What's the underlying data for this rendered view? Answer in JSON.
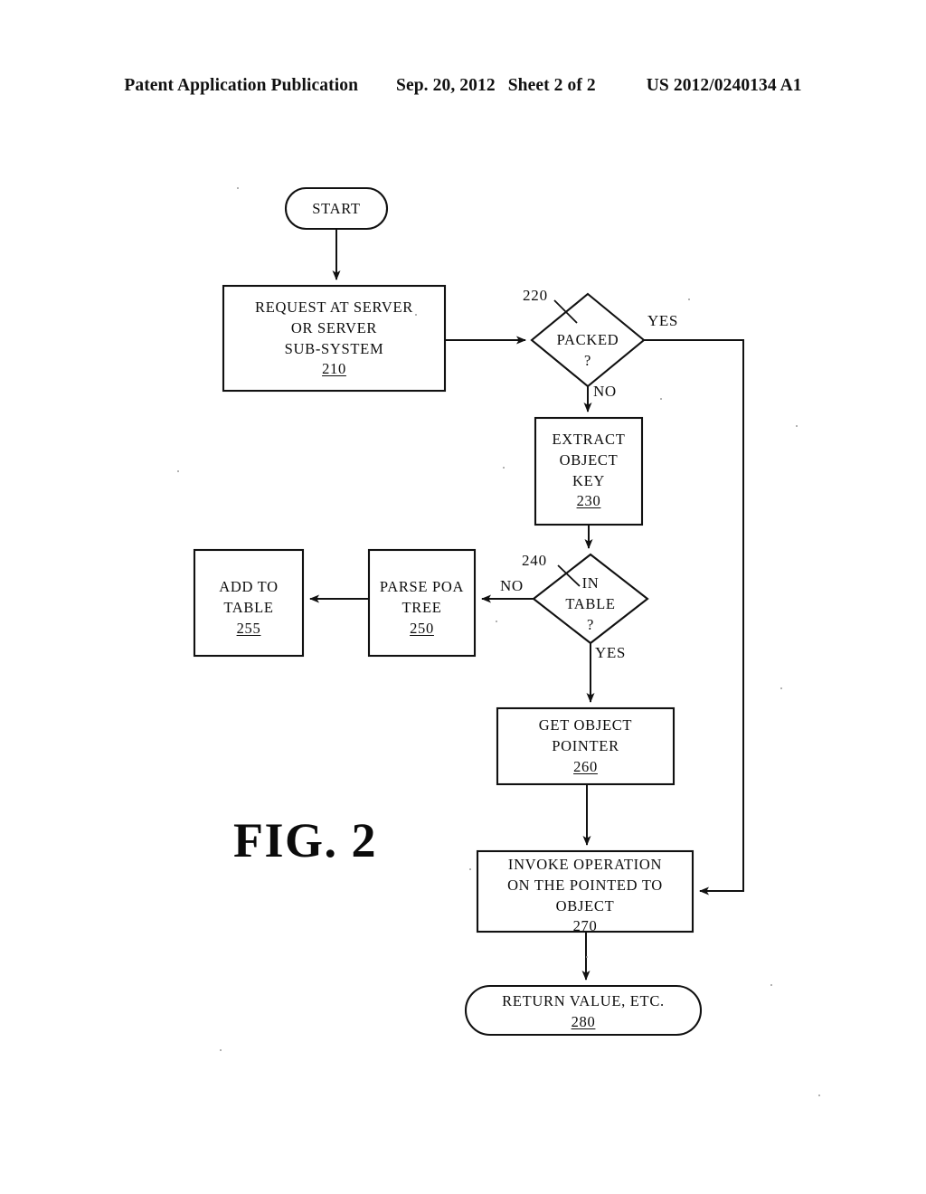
{
  "header": {
    "publication": "Patent Application Publication",
    "date": "Sep. 20, 2012",
    "sheet": "Sheet 2 of 2",
    "document_number": "US 2012/0240134 A1"
  },
  "figure": {
    "caption": "FIG. 2",
    "nodes": {
      "start": {
        "label": "START",
        "shape": "terminator"
      },
      "request": {
        "line1": "REQUEST AT SERVER",
        "line2": "OR SERVER",
        "line3": "SUB-SYSTEM",
        "ref": "210",
        "shape": "process"
      },
      "packed": {
        "line1": "PACKED",
        "line2": "?",
        "ref": "220",
        "shape": "decision"
      },
      "extract": {
        "line1": "EXTRACT",
        "line2": "OBJECT",
        "line3": "KEY",
        "ref": "230",
        "shape": "process"
      },
      "in_table": {
        "line1": "IN",
        "line2": "TABLE",
        "line3": "?",
        "ref": "240",
        "shape": "decision"
      },
      "parse": {
        "line1": "PARSE POA",
        "line2": "TREE",
        "ref": "250",
        "shape": "process"
      },
      "add_table": {
        "line1": "ADD TO",
        "line2": "TABLE",
        "ref": "255",
        "shape": "process"
      },
      "get_pointer": {
        "line1": "GET OBJECT",
        "line2": "POINTER",
        "ref": "260",
        "shape": "process"
      },
      "invoke": {
        "line1": "INVOKE OPERATION",
        "line2": "ON THE POINTED TO",
        "line3": "OBJECT",
        "ref": "270",
        "shape": "process"
      },
      "return": {
        "line1": "RETURN VALUE, ETC.",
        "ref": "280",
        "shape": "terminator"
      }
    },
    "edge_labels": {
      "packed_yes": "YES",
      "packed_no": "NO",
      "in_table_no": "NO",
      "in_table_yes": "YES"
    },
    "colors": {
      "ink": "#111111",
      "paper": "#ffffff"
    }
  }
}
